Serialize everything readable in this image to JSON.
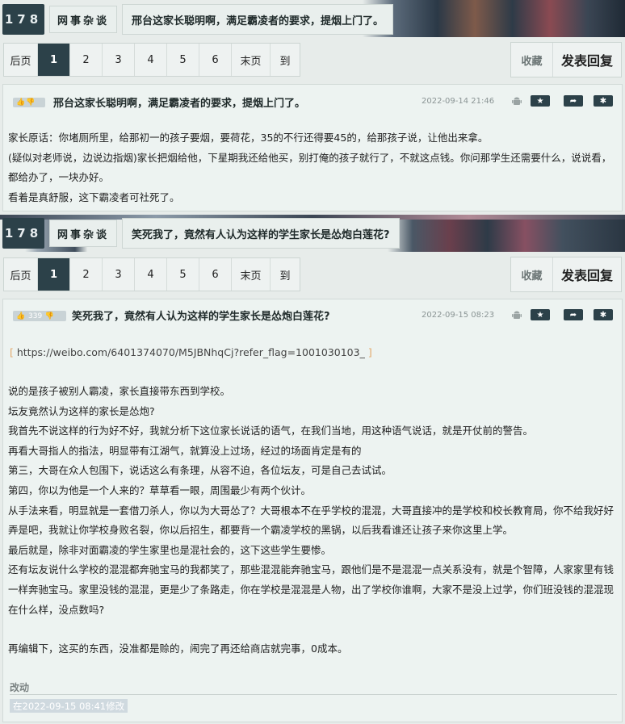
{
  "thread1": {
    "crumb": {
      "number": "178",
      "forum": "网事杂谈",
      "title": "邢台这家长聪明啊，满足霸凌者的要求，提烟上门了。"
    },
    "pager": {
      "first": "后页",
      "pages": [
        "1",
        "2",
        "3",
        "4",
        "5",
        "6"
      ],
      "last": "末页",
      "goto": "到"
    },
    "actions": {
      "favorite": "收藏",
      "reply": "发表回复"
    },
    "post": {
      "votes": "",
      "title": "邢台这家长聪明啊，满足霸凌者的要求，提烟上门了。",
      "date": "2022-09-14 21:46",
      "lines": [
        "家长原话：你堵厕所里，给那初一的孩子要烟，要荷花，35的不行还得要45的，给那孩子说，让他出来拿。",
        "(疑似对老师说，边说边指烟)家长把烟给他，下星期我还给他买，别打俺的孩子就行了，不就这点钱。你问那学生还需要什么，说说看，都给办了，一块办好。",
        "看着是真舒服，这下霸凌者可社死了。"
      ]
    }
  },
  "thread2": {
    "crumb": {
      "number": "178",
      "forum": "网事杂谈",
      "title": "笑死我了，竟然有人认为这样的学生家长是怂炮白莲花?"
    },
    "pager": {
      "first": "后页",
      "pages": [
        "1",
        "2",
        "3",
        "4",
        "5",
        "6"
      ],
      "last": "末页",
      "goto": "到"
    },
    "actions": {
      "favorite": "收藏",
      "reply": "发表回复"
    },
    "post": {
      "votes": "339",
      "title": "笑死我了，竟然有人认为这样的学生家长是怂炮白莲花?",
      "date": "2022-09-15 08:23",
      "link": "https://weibo.com/6401374070/M5JBNhqCj?refer_flag=1001030103_",
      "lines": [
        "说的是孩子被别人霸凌，家长直接带东西到学校。",
        "坛友竟然认为这样的家长是怂炮?",
        "我首先不说这样的行为好不好，我就分析下这位家长说话的语气，在我们当地，用这种语气说话，就是开仗前的警告。",
        "再看大哥指人的指法，明显带有江湖气，就算没上过场，经过的场面肯定是有的",
        "第三，大哥在众人包围下，说话这么有条理，从容不迫，各位坛友，可是自己去试试。",
        "第四，你以为他是一个人来的？草草看一眼，周围最少有两个伙计。",
        "从手法来看，明显就是一套借刀杀人，你以为大哥怂了？大哥根本不在乎学校的混混，大哥直接冲的是学校和校长教育局，你不给我好好弄是吧，我就让你学校身败名裂，你以后招生，都要背一个霸凌学校的黑锅，以后我看谁还让孩子来你这里上学。",
        "最后就是，除非对面霸凌的学生家里也是混社会的，这下这些学生要惨。",
        "还有坛友说什么学校的混混都奔驰宝马的我都笑了，那些混混能奔驰宝马，跟他们是不是混混一点关系没有，就是个智障，人家家里有钱一样奔驰宝马。家里没钱的混混，更是少了条路走，你在学校是混混是人物，出了学校你谁啊，大家不是没上过学，你们班没钱的混混现在什么样，没点数吗?",
        "",
        "再编辑下，这买的东西，没准都是赊的，闹完了再还给商店就完事，0成本。"
      ],
      "edit_label": "改动",
      "edit_note": "在2022-09-15 08:41修改"
    }
  },
  "icons": {
    "star": "★",
    "share": "➦",
    "gear": "✱"
  }
}
